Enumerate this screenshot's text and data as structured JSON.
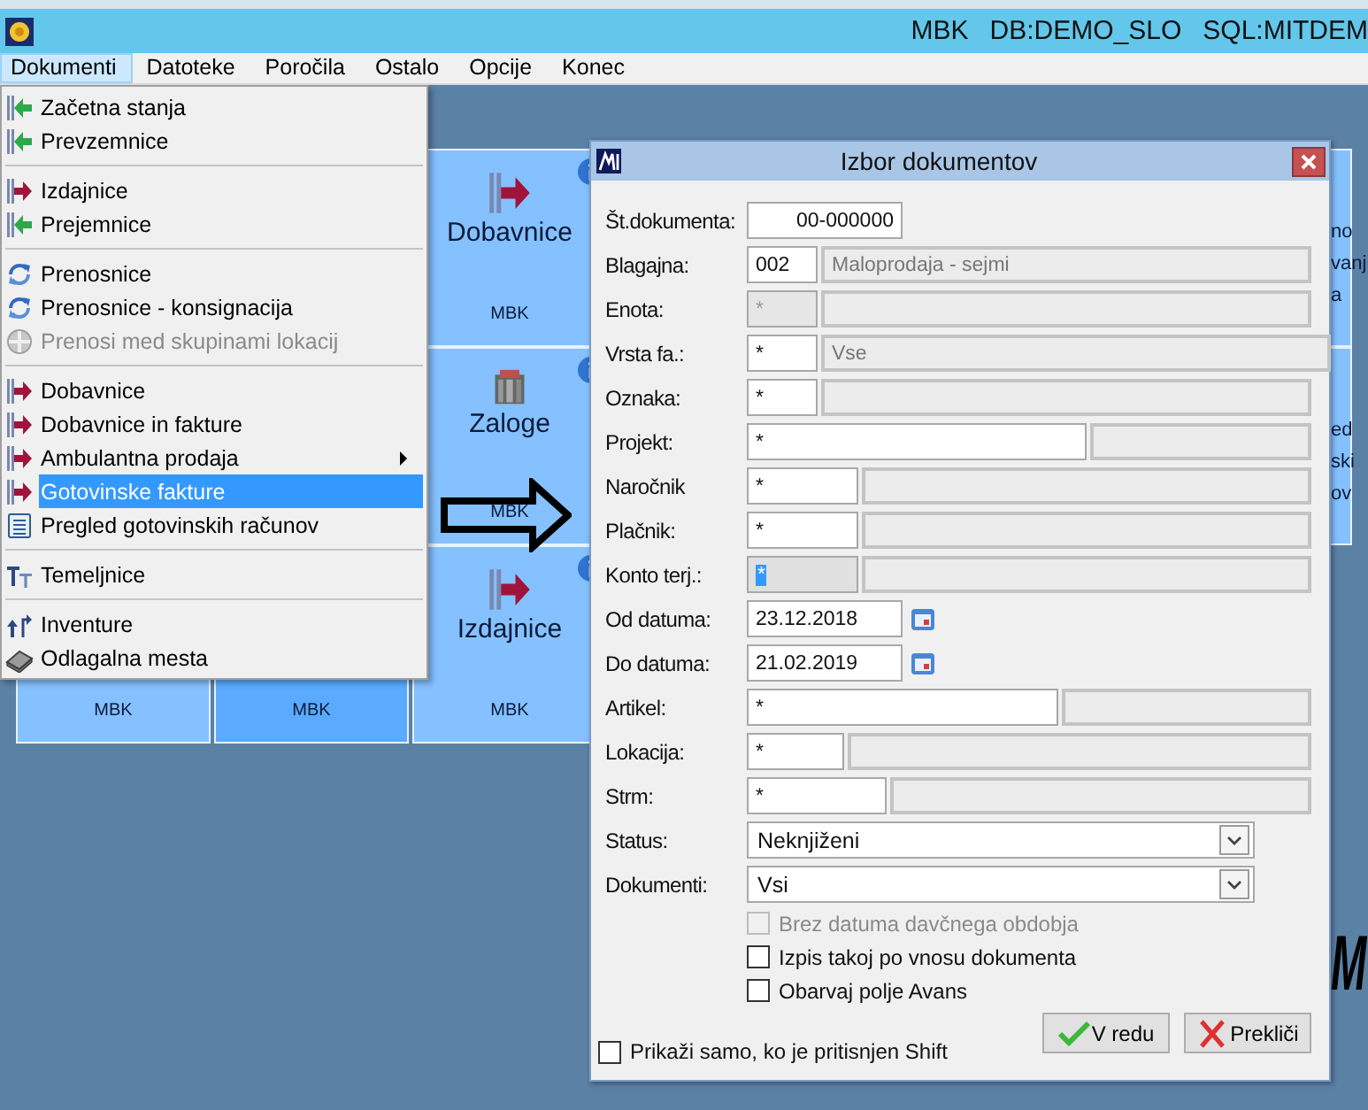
{
  "titlebar": {
    "texts": [
      "MBK",
      "DB:DEMO_SLO",
      "SQL:MITDEM"
    ]
  },
  "menubar": [
    {
      "label": "Dokumenti",
      "selected": true
    },
    {
      "label": "Datoteke",
      "selected": false
    },
    {
      "label": "Poročila",
      "selected": false
    },
    {
      "label": "Ostalo",
      "selected": false
    },
    {
      "label": "Opcije",
      "selected": false
    },
    {
      "label": "Konec",
      "selected": false
    }
  ],
  "menu": {
    "groups": [
      [
        {
          "label": "Začetna stanja",
          "kind": "receipt",
          "disabled": false,
          "selected": false,
          "submenu": false
        },
        {
          "label": "Prevzemnice",
          "kind": "receipt",
          "disabled": false,
          "selected": false,
          "submenu": false
        }
      ],
      [
        {
          "label": "Izdajnice",
          "kind": "issue",
          "disabled": false,
          "selected": false,
          "submenu": false
        },
        {
          "label": "Prejemnice",
          "kind": "receipt",
          "disabled": false,
          "selected": false,
          "submenu": false
        }
      ],
      [
        {
          "label": "Prenosnice",
          "kind": "transfer",
          "disabled": false,
          "selected": false,
          "submenu": false
        },
        {
          "label": "Prenosnice - konsignacija",
          "kind": "transfer",
          "disabled": false,
          "selected": false,
          "submenu": false
        },
        {
          "label": "Prenosi med skupinami lokacij",
          "kind": "group",
          "disabled": true,
          "selected": false,
          "submenu": false
        }
      ],
      [
        {
          "label": "Dobavnice",
          "kind": "issue",
          "disabled": false,
          "selected": false,
          "submenu": false
        },
        {
          "label": "Dobavnice in fakture",
          "kind": "issue",
          "disabled": false,
          "selected": false,
          "submenu": false
        },
        {
          "label": "Ambulantna prodaja",
          "kind": "issue",
          "disabled": false,
          "selected": false,
          "submenu": true
        },
        {
          "label": "Gotovinske fakture",
          "kind": "issue",
          "disabled": false,
          "selected": true,
          "submenu": false
        },
        {
          "label": "Pregled gotovinskih računov",
          "kind": "list",
          "disabled": false,
          "selected": false,
          "submenu": false
        }
      ],
      [
        {
          "label": "Temeljnice",
          "kind": "journal",
          "disabled": false,
          "selected": false,
          "submenu": false
        }
      ],
      [
        {
          "label": "Inventure",
          "kind": "inventory",
          "disabled": false,
          "selected": false,
          "submenu": false
        },
        {
          "label": "Odlagalna mesta",
          "kind": "storage",
          "disabled": false,
          "selected": false,
          "submenu": false
        }
      ]
    ]
  },
  "tiles": [
    [
      {
        "label": "Dobavnice",
        "footer": "MBK",
        "kind": "issue",
        "info": true,
        "selected": false
      },
      {
        "lines": [
          "no",
          "vanj",
          "a"
        ],
        "selected": false
      }
    ],
    [
      {
        "label": "Zaloge",
        "footer": "MBK",
        "kind": "stock",
        "info": true,
        "selected": false
      },
      {
        "lines": [
          "ed",
          "ski",
          "ov"
        ],
        "selected": false
      }
    ],
    [
      {
        "footer": "MBK",
        "selected": false
      },
      {
        "footer": "MBK",
        "selected": true
      },
      {
        "label": "Izdajnice",
        "footer": "MBK",
        "kind": "issue",
        "info": true,
        "selected": false
      }
    ]
  ],
  "background_text": "M",
  "dialog": {
    "title": "Izbor dokumentov",
    "fields": [
      {
        "label": "Št.dokumenta:",
        "kind": "number",
        "value": "00-000000",
        "disabled": false
      },
      {
        "label": "Blagajna:",
        "kind": "lookup",
        "value": "002",
        "description": "Maloprodaja - sejmi",
        "disabled": false
      },
      {
        "label": "Enota:",
        "kind": "lookup",
        "value": "*",
        "disabled": true
      },
      {
        "label": "Vrsta fa.:",
        "kind": "lookup",
        "value": "*",
        "description": "Vse",
        "disabled": false
      },
      {
        "label": "Oznaka:",
        "kind": "lookup",
        "value": "*",
        "disabled": false
      },
      {
        "label": "Projekt:",
        "kind": "lookup",
        "value": "*",
        "disabled": false
      },
      {
        "label": "Naročnik",
        "kind": "lookup",
        "value": "*",
        "disabled": false
      },
      {
        "label": "Plačnik:",
        "kind": "lookup",
        "value": "*",
        "disabled": false
      },
      {
        "label": "Konto terj.:",
        "kind": "lookup",
        "value": "*",
        "disabled": false,
        "highlighted": true
      },
      {
        "label": "Od datuma:",
        "kind": "date",
        "value": "23.12.2018",
        "disabled": false
      },
      {
        "label": "Do datuma:",
        "kind": "date",
        "value": "21.02.2019",
        "disabled": false
      },
      {
        "label": "Artikel:",
        "kind": "lookup",
        "value": "*",
        "disabled": false
      },
      {
        "label": "Lokacija:",
        "kind": "lookup",
        "value": "*",
        "disabled": false
      },
      {
        "label": "Strm:",
        "kind": "lookup",
        "value": "*",
        "disabled": false
      },
      {
        "label": "Status:",
        "kind": "select",
        "value": "Neknjiženi"
      },
      {
        "label": "Dokumenti:",
        "kind": "select",
        "value": "Vsi"
      }
    ],
    "checkboxes": [
      {
        "label": "Brez datuma davčnega obdobja",
        "checked": false,
        "disabled": true
      },
      {
        "label": "Izpis takoj po vnosu dokumenta",
        "checked": false,
        "disabled": false
      },
      {
        "label": "Obarvaj polje Avans",
        "checked": false,
        "disabled": false
      }
    ],
    "shift_option": {
      "label": "Prikaži samo, ko je pritisnjen Shift",
      "checked": false
    },
    "buttons": [
      {
        "label": "V redu",
        "kind": "ok"
      },
      {
        "label": "Prekliči",
        "kind": "cancel"
      }
    ]
  }
}
